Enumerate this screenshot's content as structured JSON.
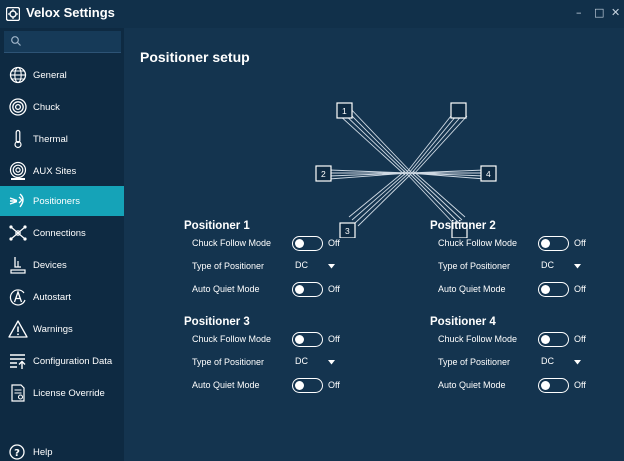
{
  "window": {
    "title": "Velox Settings"
  },
  "search": {
    "placeholder": ""
  },
  "sidebar": {
    "items": [
      {
        "label": "General",
        "icon": "globe-icon",
        "active": false
      },
      {
        "label": "Chuck",
        "icon": "chuck-icon",
        "active": false
      },
      {
        "label": "Thermal",
        "icon": "thermometer-icon",
        "active": false
      },
      {
        "label": "AUX Sites",
        "icon": "aux-sites-icon",
        "active": false
      },
      {
        "label": "Positioners",
        "icon": "positioner-icon",
        "active": true
      },
      {
        "label": "Connections",
        "icon": "connections-icon",
        "active": false
      },
      {
        "label": "Devices",
        "icon": "devices-icon",
        "active": false
      },
      {
        "label": "Autostart",
        "icon": "autostart-icon",
        "active": false
      },
      {
        "label": "Warnings",
        "icon": "warning-icon",
        "active": false
      },
      {
        "label": "Configuration Data",
        "icon": "configuration-data-icon",
        "active": false
      },
      {
        "label": "License Override",
        "icon": "license-icon",
        "active": false
      }
    ],
    "help_label": "Help"
  },
  "main": {
    "title": "Positioner setup",
    "diagram": {
      "labels": [
        "1",
        "2",
        "3",
        "4"
      ]
    },
    "positioners": [
      {
        "title": "Positioner 1",
        "chuck_follow_label": "Chuck Follow Mode",
        "chuck_follow_value": "Off",
        "type_label": "Type of Positioner",
        "type_value": "DC",
        "auto_quiet_label": "Auto Quiet Mode",
        "auto_quiet_value": "Off"
      },
      {
        "title": "Positioner 2",
        "chuck_follow_label": "Chuck Follow Mode",
        "chuck_follow_value": "Off",
        "type_label": "Type of Positioner",
        "type_value": "DC",
        "auto_quiet_label": "Auto Quiet Mode",
        "auto_quiet_value": "Off"
      },
      {
        "title": "Positioner 3",
        "chuck_follow_label": "Chuck Follow Mode",
        "chuck_follow_value": "Off",
        "type_label": "Type of Positioner",
        "type_value": "DC",
        "auto_quiet_label": "Auto Quiet Mode",
        "auto_quiet_value": "Off"
      },
      {
        "title": "Positioner 4",
        "chuck_follow_label": "Chuck Follow Mode",
        "chuck_follow_value": "Off",
        "type_label": "Type of Positioner",
        "type_value": "DC",
        "auto_quiet_label": "Auto Quiet Mode",
        "auto_quiet_value": "Off"
      }
    ]
  },
  "colors": {
    "accent": "#15a3b8",
    "sidebar_bg": "#0e2a42",
    "main_bg": "#14344f",
    "titlebar_bg": "#11304a"
  }
}
